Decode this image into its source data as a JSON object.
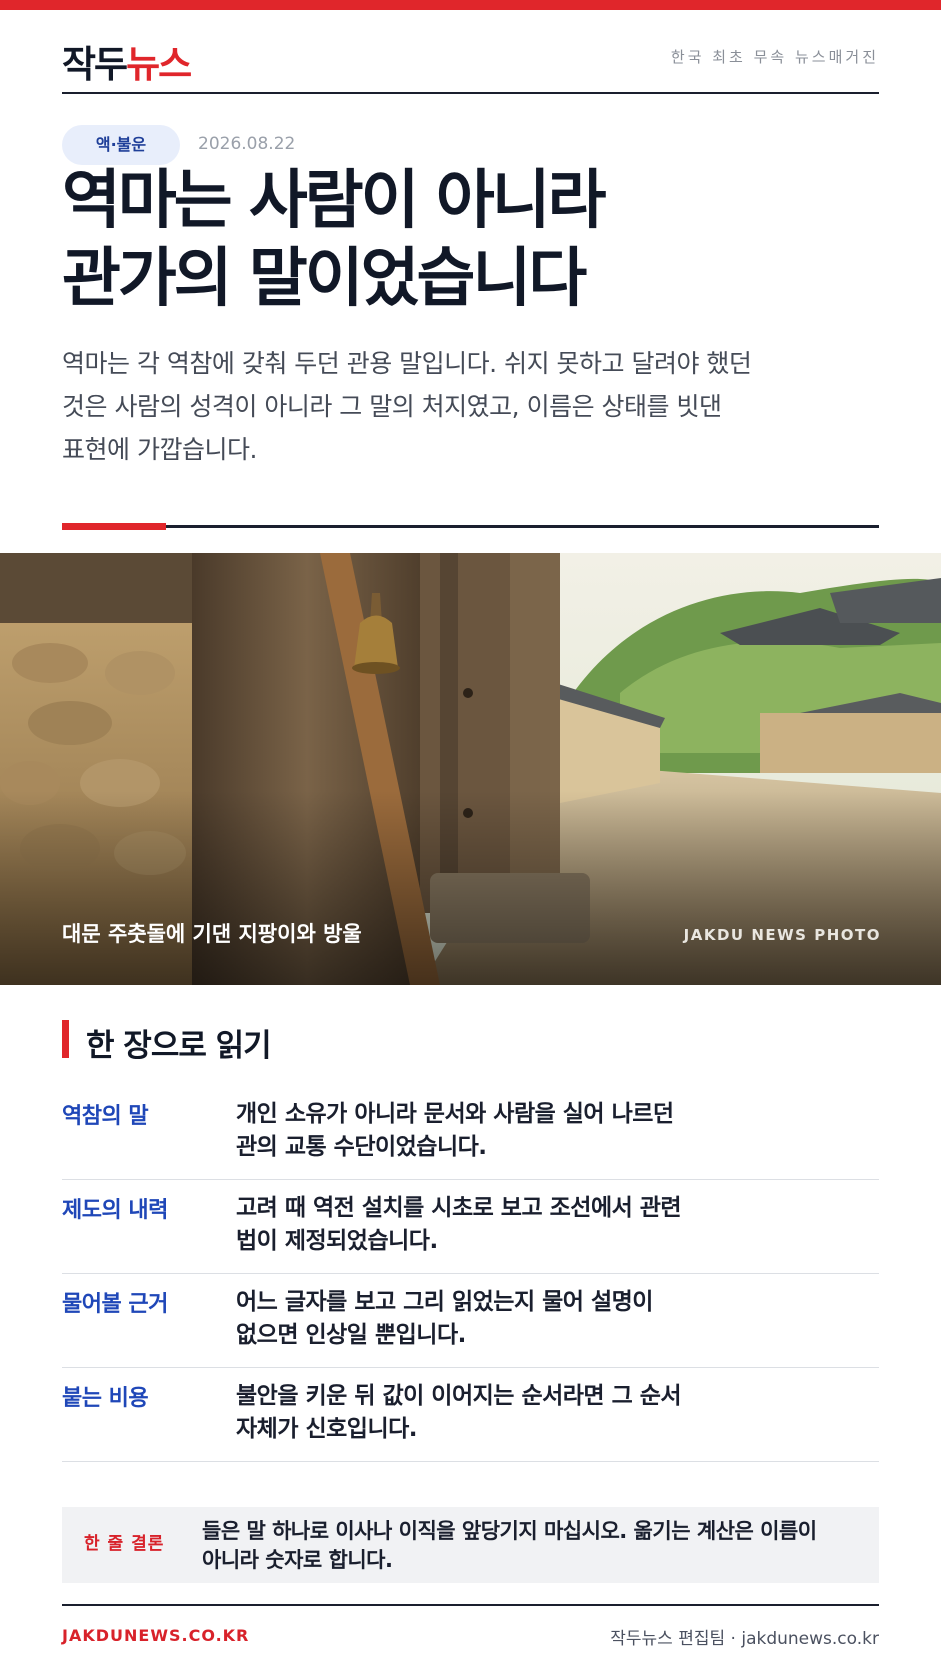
{
  "brand": {
    "logo_dark": "작두",
    "logo_red": "뉴스",
    "tagline": "한국 최초 무속 뉴스매거진",
    "accent_color": "#e0262b",
    "link_color": "#1f47b8"
  },
  "article": {
    "category": "액·불운",
    "date": "2026.08.22",
    "headline_lines": [
      "역마는 사람이 아니라",
      "관가의 말이었습니다"
    ],
    "deck_lines": [
      "역마는 각 역참에 갖춰 두던 관용 말입니다. 쉬지 못하고 달려야 했던",
      "것은 사람의 성격이 아니라 그 말의 처지였고, 이름은 상태를 빗댄",
      "표현에 가깝습니다."
    ]
  },
  "photo": {
    "caption": "대문 주춧돌에 기댄 지팡이와 방울",
    "credit": "JAKDU NEWS PHOTO"
  },
  "summary": {
    "title": "한 장으로 읽기",
    "rows": [
      {
        "label": "역참의 말",
        "lines": [
          "개인 소유가 아니라 문서와 사람을 실어 나르던",
          "관의 교통 수단이었습니다."
        ]
      },
      {
        "label": "제도의 내력",
        "lines": [
          "고려 때 역전 설치를 시초로 보고 조선에서 관련",
          "법이 제정되었습니다."
        ]
      },
      {
        "label": "물어볼 근거",
        "lines": [
          "어느 글자를 보고 그리 읽었는지 물어 설명이",
          "없으면 인상일 뿐입니다."
        ]
      },
      {
        "label": "붙는 비용",
        "lines": [
          "불안을 키운 뒤 값이 이어지는 순서라면 그 순서",
          "자체가 신호입니다."
        ]
      }
    ]
  },
  "conclusion": {
    "label": "한 줄 결론",
    "lines": [
      "들은 말 하나로 이사나 이직을 앞당기지 마십시오. 옮기는 계산은 이름이",
      "아니라 숫자로 합니다."
    ]
  },
  "footer": {
    "site": "JAKDUNEWS.CO.KR",
    "credit": "작두뉴스 편집팀 · jakdunews.co.kr"
  }
}
